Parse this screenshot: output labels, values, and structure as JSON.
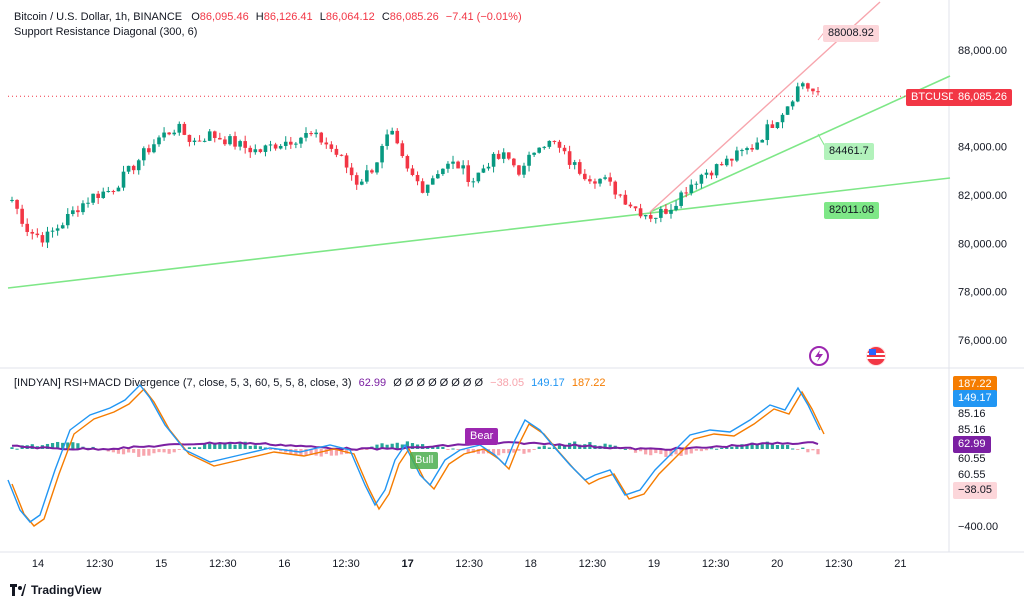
{
  "header": {
    "symbol": "Bitcoin / U.S. Dollar, 1h, BINANCE",
    "o_label": "O",
    "o_value": "86,095.46",
    "h_label": "H",
    "h_value": "86,126.41",
    "l_label": "L",
    "l_value": "86,064.12",
    "c_label": "C",
    "c_value": "86,085.26",
    "change": "−7.41 (−0.01%)",
    "indicator": "Support Resistance Diagonal (300, 6)"
  },
  "indicator_panel": {
    "title": "[INDYAN] RSI+MACD Divergence (7, close, 5, 3, 60, 5, 5, 8, close, 3)",
    "v1": "62.99",
    "zeros": "Ø Ø Ø Ø Ø Ø Ø Ø",
    "v2": "−38.05",
    "v3": "149.17",
    "v4": "187.22"
  },
  "price_axis": [
    "88,000.00",
    "86,000.00",
    "84,000.00",
    "82,000.00",
    "80,000.00",
    "78,000.00",
    "76,000.00"
  ],
  "ind_axis": [
    "85.16",
    "85.16",
    "60.55",
    "60.55",
    "−400.00"
  ],
  "time_axis": [
    "14",
    "12:30",
    "15",
    "12:30",
    "16",
    "12:30",
    "17",
    "12:30",
    "18",
    "12:30",
    "19",
    "12:30",
    "20",
    "12:30",
    "21"
  ],
  "labels": {
    "resistance": "88008.92",
    "support_upper": "84461.7",
    "support_lower": "82011.08",
    "symbol_tag": "BTCUSD",
    "last_price": "86,085.26",
    "ind_187": "187.22",
    "ind_149": "149.17",
    "ind_6299": "62.99",
    "ind_neg38": "−38.05",
    "bear": "Bear",
    "bull": "Bull"
  },
  "brand": "TradingView",
  "colors": {
    "up": "#089981",
    "down": "#f23645",
    "support": "#7ee787",
    "resistance": "#f7a5ad",
    "rsi": "#7b1fa2",
    "macd_blue": "#2196f3",
    "macd_orange": "#f57c00"
  },
  "chart_data": {
    "type": "candlestick",
    "title": "Bitcoin / U.S. Dollar, 1h, BINANCE",
    "ylim": [
      75500,
      89000
    ],
    "approx_closes": [
      81800,
      80500,
      80200,
      80800,
      81500,
      82000,
      82200,
      82900,
      83700,
      84400,
      84800,
      84200,
      84500,
      84300,
      84000,
      83800,
      84100,
      84300,
      84500,
      84200,
      83500,
      82500,
      83200,
      84600,
      83000,
      82300,
      83100,
      83300,
      82600,
      83400,
      83600,
      82900,
      84200,
      84100,
      83300,
      82800,
      82600,
      82000,
      81400,
      81100,
      81500,
      82300,
      82900,
      83200,
      83600,
      84000,
      84800,
      85600,
      86700,
      86085
    ]
  }
}
